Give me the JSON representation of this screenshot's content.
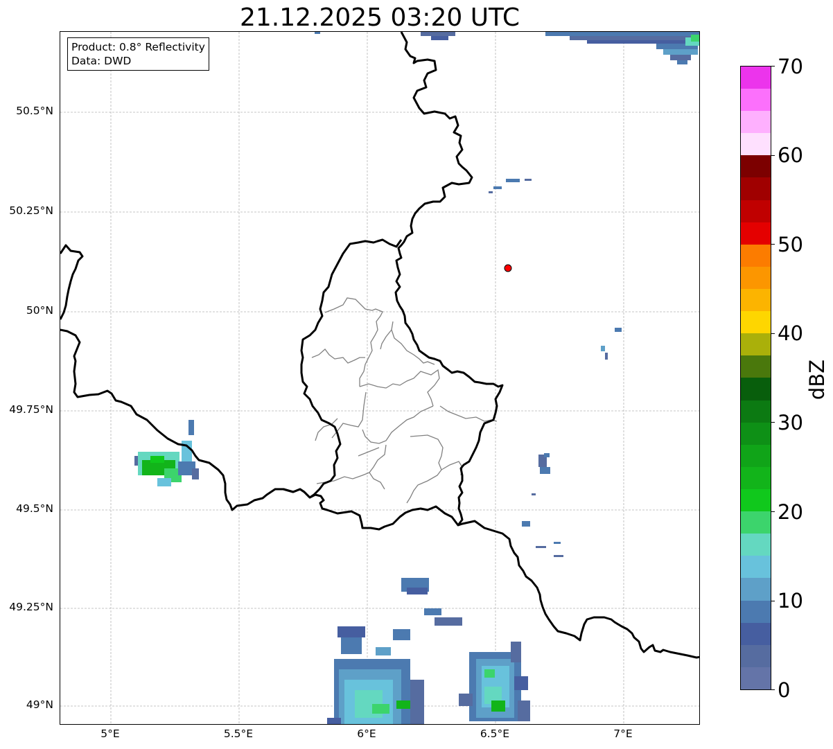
{
  "map": {
    "title": "21.12.2025 03:20 UTC",
    "info": {
      "product": "Product: 0.8° Reflectivity",
      "data_source": "Data: DWD"
    },
    "lat_ticks": [
      "50.5°N",
      "50.25°N",
      "50°N",
      "49.75°N",
      "49.5°N",
      "49.25°N",
      "49°N"
    ],
    "lon_ticks": [
      "5°E",
      "5.5°E",
      "6°E",
      "6.5°E",
      "7°E"
    ],
    "gridlines": true,
    "marker": {
      "name": "radar-site-marker",
      "color": "#ff0000",
      "lon": 6.55,
      "lat": 50.11
    }
  },
  "colorbar": {
    "label": "dBZ",
    "ticks": [
      "0",
      "10",
      "20",
      "30",
      "40",
      "50",
      "60",
      "70"
    ],
    "range": [
      0,
      70
    ],
    "step": 2.5,
    "colors": [
      "#6474a8",
      "#566ca0",
      "#465ea0",
      "#4c7ab0",
      "#5ea0c8",
      "#68c2dc",
      "#64d8c0",
      "#3cd46c",
      "#10c81c",
      "#12b41a",
      "#10a418",
      "#0e9016",
      "#0c7a12",
      "#085e0c",
      "#4a780c",
      "#aab00a",
      "#fed600",
      "#fcb400",
      "#fc9600",
      "#fc7c00",
      "#e40000",
      "#c00000",
      "#a00000",
      "#7c0000",
      "#fee0fe",
      "#feb0fe",
      "#fc70fc",
      "#ec34ec"
    ]
  }
}
